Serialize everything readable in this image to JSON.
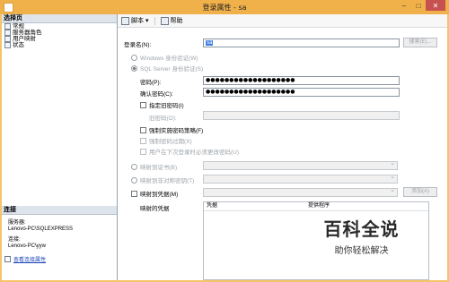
{
  "window": {
    "title": "登录属性 - sa",
    "min": "–",
    "max": "□",
    "close": "✕"
  },
  "left_pane": {
    "header": "选择页",
    "pages": [
      "常规",
      "服务器角色",
      "用户映射",
      "状态"
    ],
    "connection_header": "连接",
    "server_label": "服务器:",
    "server_value": "Lenovo-PC\\SQLEXPRESS",
    "connection_label": "连接:",
    "connection_value": "Lenovo-PC\\yyw",
    "view_link": "查看连接属性"
  },
  "toolbar": {
    "script": "脚本",
    "help": "帮助"
  },
  "form": {
    "login_name_label": "登录名(N):",
    "login_name_value": "sa",
    "search_button": "搜索(E)...",
    "windows_auth": "Windows 身份验证(W)",
    "sql_auth": "SQL Server 身份验证(S)",
    "password_label": "密码(P):",
    "password_value": "●●●●●●●●●●●●●●●●●●●",
    "confirm_label": "确认密码(C):",
    "confirm_value": "●●●●●●●●●●●●●●●●●●●",
    "specify_old": "指定旧密码(I)",
    "old_password_label": "旧密码(O):",
    "enforce_policy": "强制实施密码策略(F)",
    "enforce_expiry": "强制密码过期(X)",
    "must_change": "用户在下次登录时必须更改密码(U)",
    "map_cert": "映射到证书(B)",
    "map_asym_key": "映射到非对称密钥(T)",
    "map_credential": "映射到凭据(M)",
    "add_button": "添加(A)",
    "mapped_credentials": "映射的凭据",
    "grid_headers": [
      "凭据",
      "提供程序"
    ]
  },
  "watermark": {
    "title": "百科全说",
    "subtitle": "助你轻松解决"
  }
}
